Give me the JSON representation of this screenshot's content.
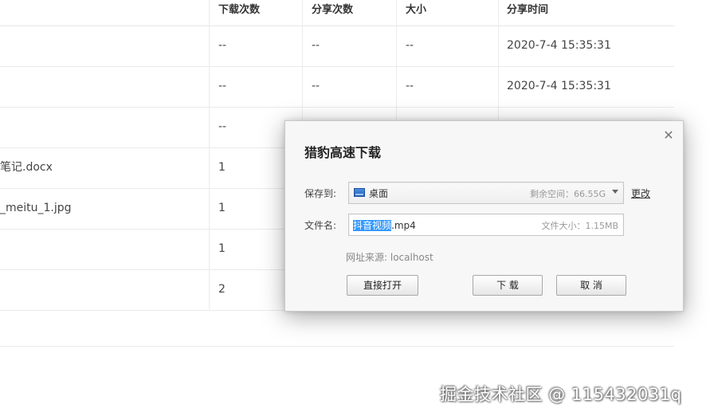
{
  "table": {
    "headers": [
      "下载次数",
      "分享次数",
      "大小",
      "分享时间"
    ],
    "rows": [
      {
        "name": "",
        "downloads": "--",
        "shares": "--",
        "size": "--",
        "time": "2020-7-4 15:35:31"
      },
      {
        "name": "",
        "downloads": "--",
        "shares": "--",
        "size": "--",
        "time": "2020-7-4 15:35:31"
      },
      {
        "name": "",
        "downloads": "--",
        "shares": "",
        "size": "",
        "time": ""
      },
      {
        "name": "笔记.docx",
        "downloads": "1",
        "shares": "",
        "size": "",
        "time": ""
      },
      {
        "name": "_meitu_1.jpg",
        "downloads": "1",
        "shares": "",
        "size": "",
        "time": ""
      },
      {
        "name": "",
        "downloads": "1",
        "shares": "",
        "size": "",
        "time": ""
      },
      {
        "name": "",
        "downloads": "2",
        "shares": "",
        "size": "",
        "time": ""
      }
    ]
  },
  "dialog": {
    "title": "猎豹高速下载",
    "close_icon": "close-icon",
    "save_label": "保存到:",
    "save_location": "桌面",
    "free_space": "剩余空间：66.55G",
    "change_link": "更改",
    "filename_label": "文件名:",
    "filename_selected": "抖音视频",
    "filename_ext": ".mp4",
    "file_size": "文件大小：1.15MB",
    "source": "网址来源: localhost",
    "open_button": "直接打开",
    "download_button": "下 载",
    "cancel_button": "取 消"
  },
  "watermark": "掘金技术社区 @ 115432031q"
}
